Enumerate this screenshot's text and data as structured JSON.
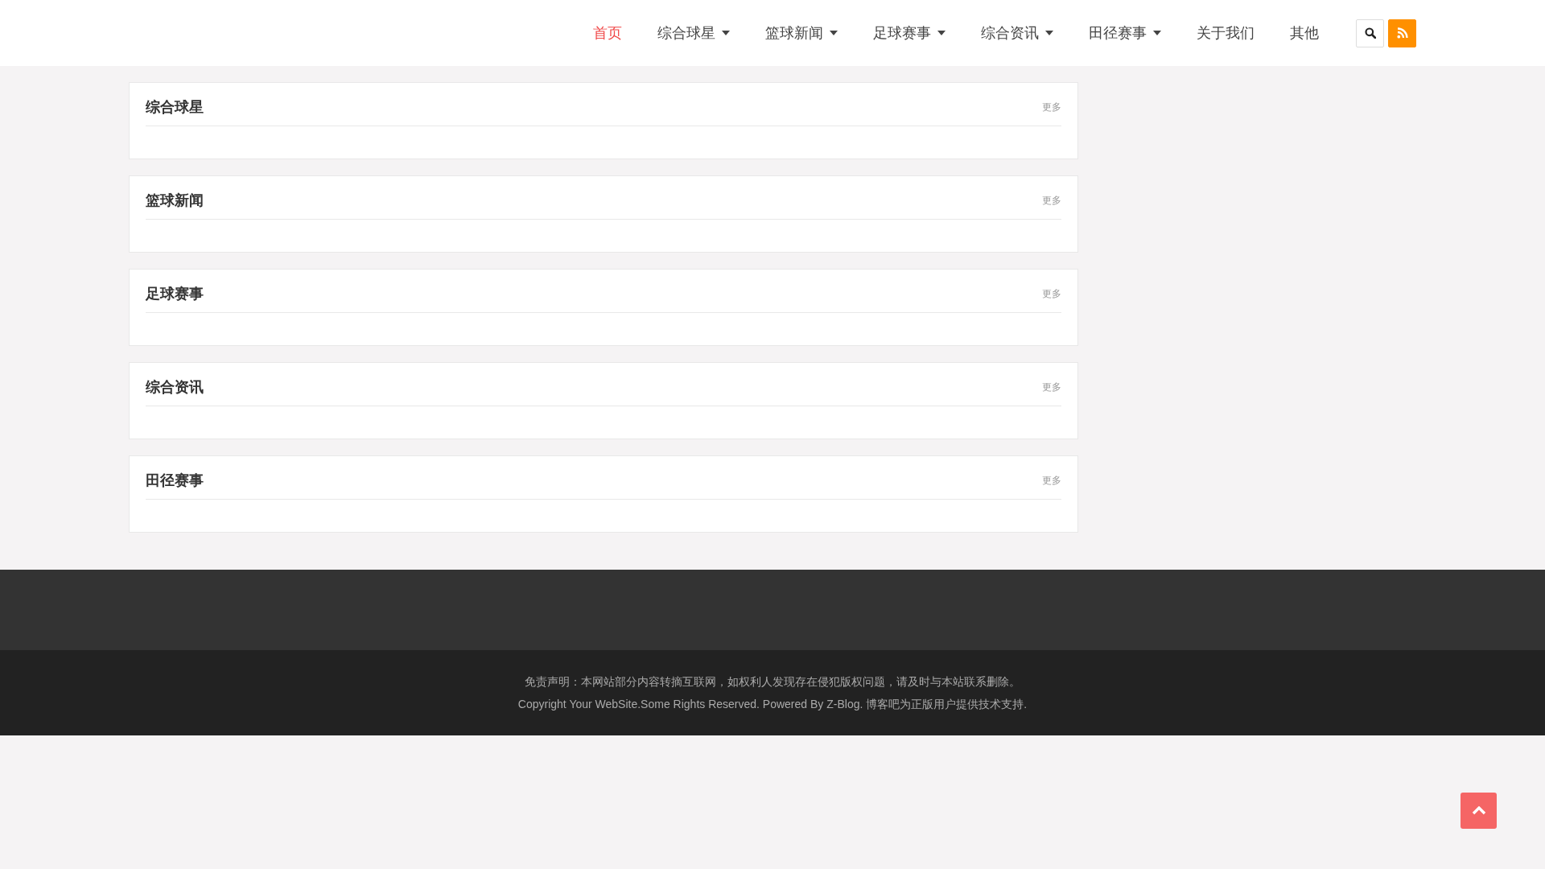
{
  "nav": {
    "items": [
      {
        "label": "首页",
        "selected": true,
        "dropdown": false
      },
      {
        "label": "综合球星",
        "selected": false,
        "dropdown": true
      },
      {
        "label": "篮球新闻",
        "selected": false,
        "dropdown": true
      },
      {
        "label": "足球赛事",
        "selected": false,
        "dropdown": true
      },
      {
        "label": "综合资讯",
        "selected": false,
        "dropdown": true
      },
      {
        "label": "田径赛事",
        "selected": false,
        "dropdown": true
      },
      {
        "label": "关于我们",
        "selected": false,
        "dropdown": false
      },
      {
        "label": "其他",
        "selected": false,
        "dropdown": false
      }
    ]
  },
  "sections": [
    {
      "title": "综合球星",
      "more": "更多"
    },
    {
      "title": "篮球新闻",
      "more": "更多"
    },
    {
      "title": "足球赛事",
      "more": "更多"
    },
    {
      "title": "综合资讯",
      "more": "更多"
    },
    {
      "title": "田径赛事",
      "more": "更多"
    }
  ],
  "footer": {
    "disclaimer": "免责声明：本网站部分内容转摘互联网，如权利人发现存在侵犯版权问题，请及时与本站联系删除。",
    "copyright": "Copyright Your WebSite.Some Rights Reserved. Powered By Z-Blog. 博客吧为正版用户提供技术支持."
  }
}
